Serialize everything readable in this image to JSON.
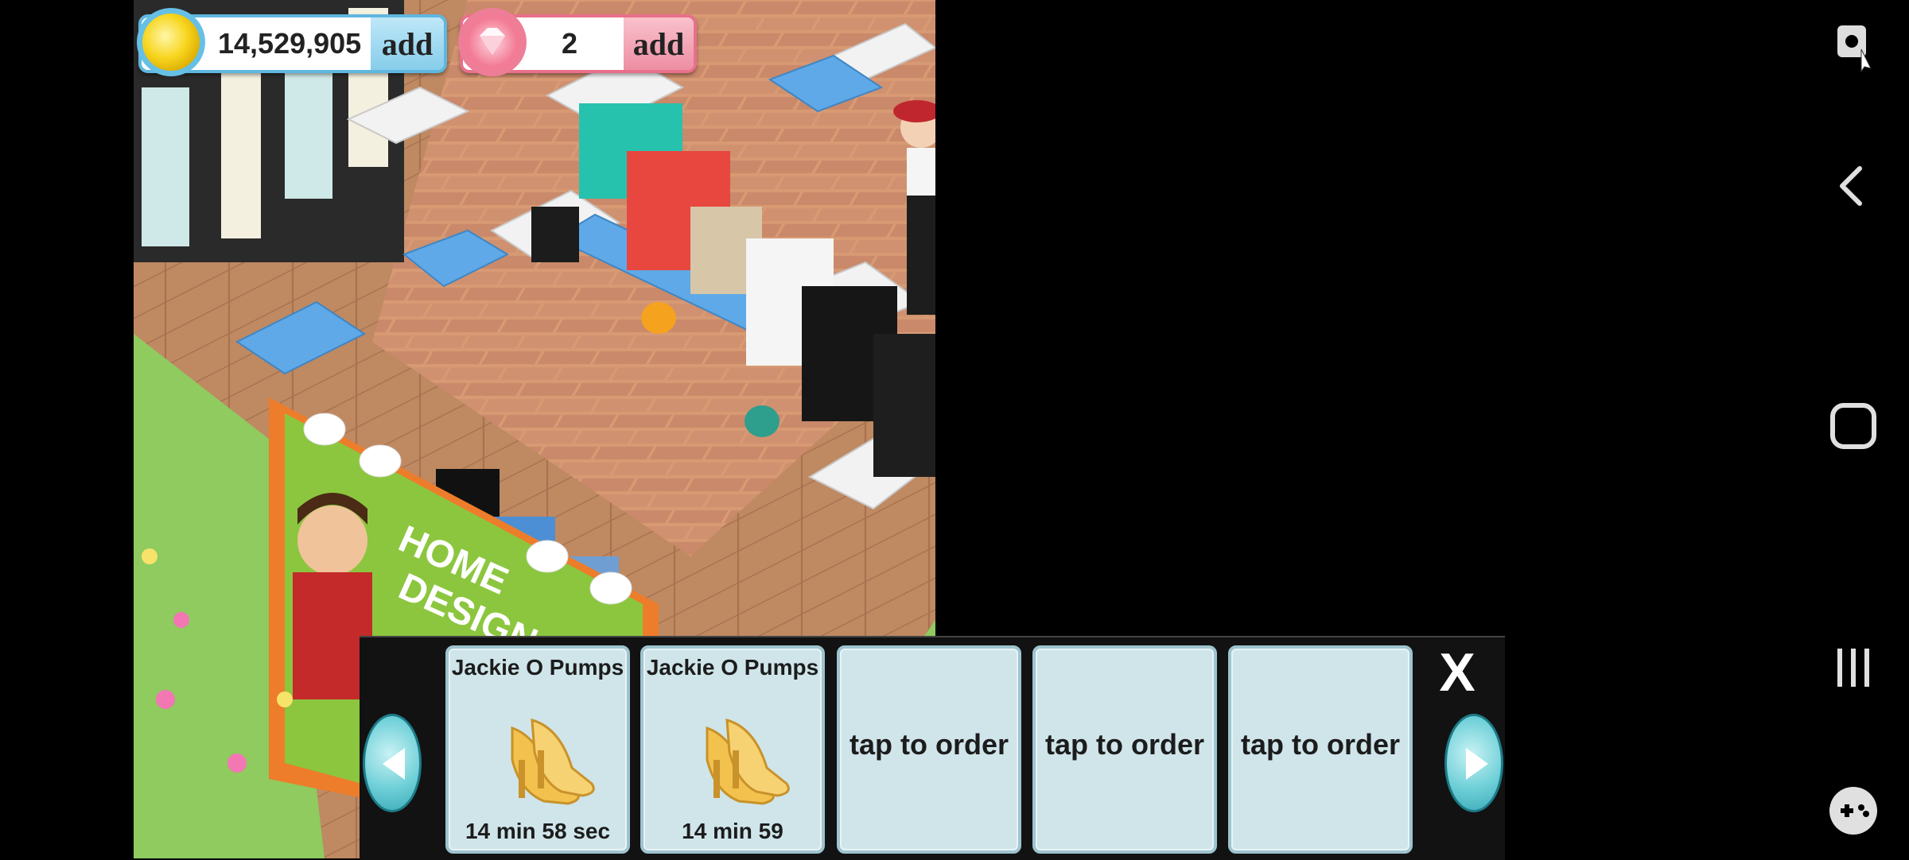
{
  "hud": {
    "coins": {
      "icon": "gold-coin-icon",
      "value": "14,529,905",
      "add_label": "add"
    },
    "gems": {
      "icon": "pink-diamond-icon",
      "value": "2",
      "add_label": "add"
    }
  },
  "order_bar": {
    "slots": [
      {
        "title": "Jackie O Pumps",
        "icon": "gold-pumps-icon",
        "timer": "14 min 58 sec"
      },
      {
        "title": "Jackie O Pumps",
        "icon": "gold-pumps-icon",
        "timer": "14 min 59"
      },
      {
        "label": "tap to order"
      },
      {
        "label": "tap to order"
      },
      {
        "label": "tap to order"
      }
    ],
    "close_label": "X",
    "prev_icon": "left-arrow-icon",
    "next_icon": "right-arrow-icon"
  },
  "system_nav": {
    "items": [
      "screen-capture-icon",
      "back-icon",
      "home-icon",
      "recents-icon",
      "game-launcher-icon"
    ]
  },
  "colors": {
    "floor": "#c08a63",
    "grass": "#8fcb5f",
    "coin_border": "#5fb7df",
    "gem_border": "#e8708a",
    "slot_bg": "#cfe5ea"
  }
}
